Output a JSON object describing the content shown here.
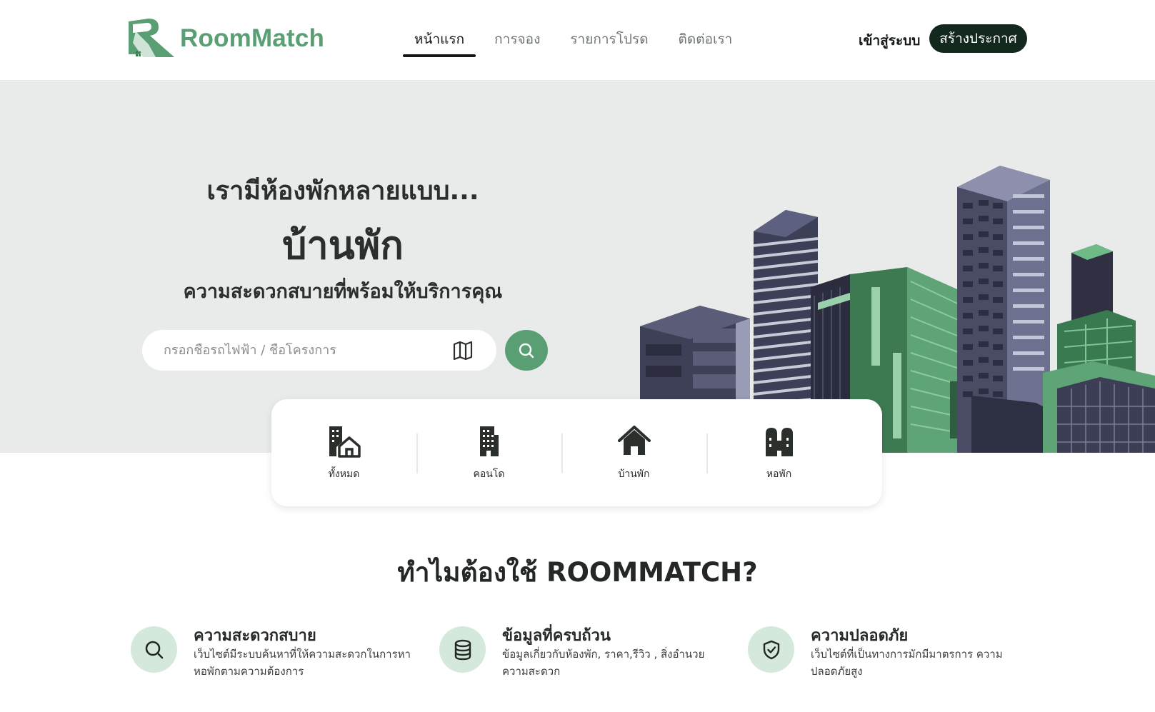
{
  "brand": {
    "name": "RoomMatch",
    "color": "#5a9e74",
    "dark": "#14291d"
  },
  "nav": {
    "items": [
      {
        "label": "หน้าแรก",
        "active": true
      },
      {
        "label": "การจอง",
        "active": false
      },
      {
        "label": "รายการโปรด",
        "active": false
      },
      {
        "label": "ติดต่อเรา",
        "active": false
      }
    ],
    "login_label": "เข้าสู่ระบบ",
    "post_label": "สร้างประกาศ"
  },
  "hero": {
    "line1": "เรามีห้องพักหลายแบบ...",
    "line2": "บ้านพัก",
    "line3": "ความสะดวกสบายที่พร้อมให้บริการคุณ",
    "search_placeholder": "กรอกชื่อรถไฟฟ้า / ชื่อโครงการ",
    "search_value": ""
  },
  "categories": [
    {
      "label": "ทั้งหมด",
      "icon": "building-house-icon"
    },
    {
      "label": "คอนโด",
      "icon": "condo-icon"
    },
    {
      "label": "บ้านพัก",
      "icon": "house-icon"
    },
    {
      "label": "หอพัก",
      "icon": "dormitory-icon"
    }
  ],
  "why": {
    "title": "ทำไมต้องใช้ ROOMMATCH?",
    "features": [
      {
        "title": "ความสะดวกสบาย",
        "desc": "เว็บไซต์มีระบบค้นหาที่ให้ความสะดวกในการหาหอพักตามความต้องการ",
        "icon": "search-icon"
      },
      {
        "title": "ข้อมูลที่ครบถ้วน",
        "desc": "ข้อมูลเกี่ยวกับห้องพัก, ราคา,รีวิว , สิ่งอำนวยความสะดวก",
        "icon": "database-icon"
      },
      {
        "title": "ความปลอดภัย",
        "desc": "เว็บไซต์ที่เป็นทางการมักมีมาตรการ ความปลอดภัยสูง",
        "icon": "shield-check-icon"
      }
    ]
  }
}
